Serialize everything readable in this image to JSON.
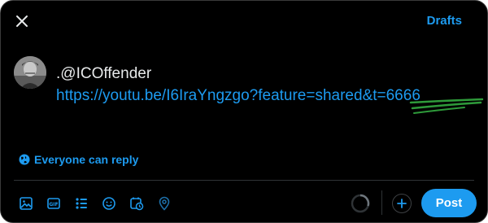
{
  "header": {
    "drafts_label": "Drafts"
  },
  "composer": {
    "mention": ".@ICOffender",
    "link": "https://youtu.be/I6IraYngzgo?feature=shared&t=6666"
  },
  "reply_setting": {
    "label": "Everyone can reply"
  },
  "toolbar": {
    "icons": [
      "image-icon",
      "gif-icon",
      "poll-icon",
      "emoji-icon",
      "schedule-icon",
      "location-icon"
    ],
    "post_label": "Post"
  },
  "colors": {
    "accent": "#1d9bf0",
    "background": "#000000",
    "text": "#e7e9ea",
    "annotation": "#2e9a3a"
  }
}
